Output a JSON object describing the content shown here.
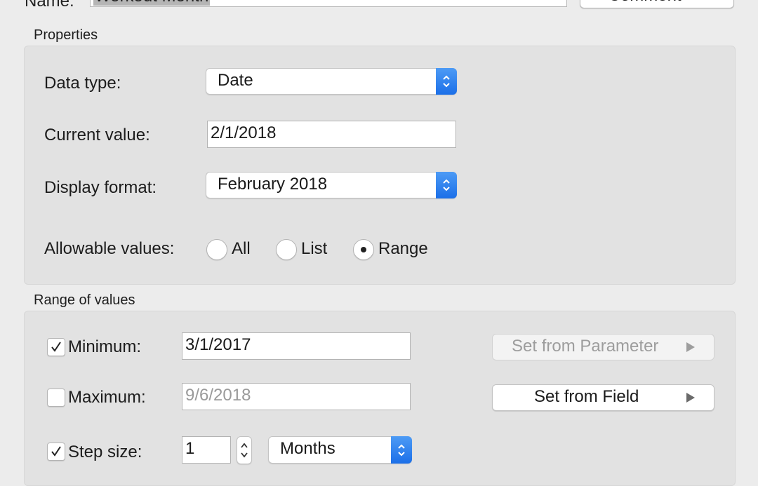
{
  "top": {
    "name_label": "Name:",
    "name_value": "Workout Month",
    "comment_button": "Comment >>"
  },
  "properties": {
    "section_title": "Properties",
    "data_type_label": "Data type:",
    "data_type_value": "Date",
    "current_value_label": "Current value:",
    "current_value": "2/1/2018",
    "display_format_label": "Display format:",
    "display_format_value": "February 2018",
    "allowable_label": "Allowable values:",
    "allowable_options": [
      "All",
      "List",
      "Range"
    ],
    "allowable_selected": "Range"
  },
  "range": {
    "section_title": "Range of values",
    "minimum_label": "Minimum:",
    "minimum_checked": true,
    "minimum_value": "3/1/2017",
    "maximum_label": "Maximum:",
    "maximum_checked": false,
    "maximum_value": "9/6/2018",
    "step_label": "Step size:",
    "step_checked": true,
    "step_value": "1",
    "step_unit": "Months",
    "set_from_parameter": "Set from Parameter",
    "set_from_field": "Set from Field"
  },
  "icons": {
    "select_arrows": "chevron-updown-icon",
    "submenu": "triangle-right-icon",
    "check": "checkmark-icon",
    "stepper": "stepper-arrows-icon"
  },
  "colors": {
    "accent": "#2a7cf0",
    "window_bg": "#ececec",
    "group_bg": "#e2e2e2"
  }
}
